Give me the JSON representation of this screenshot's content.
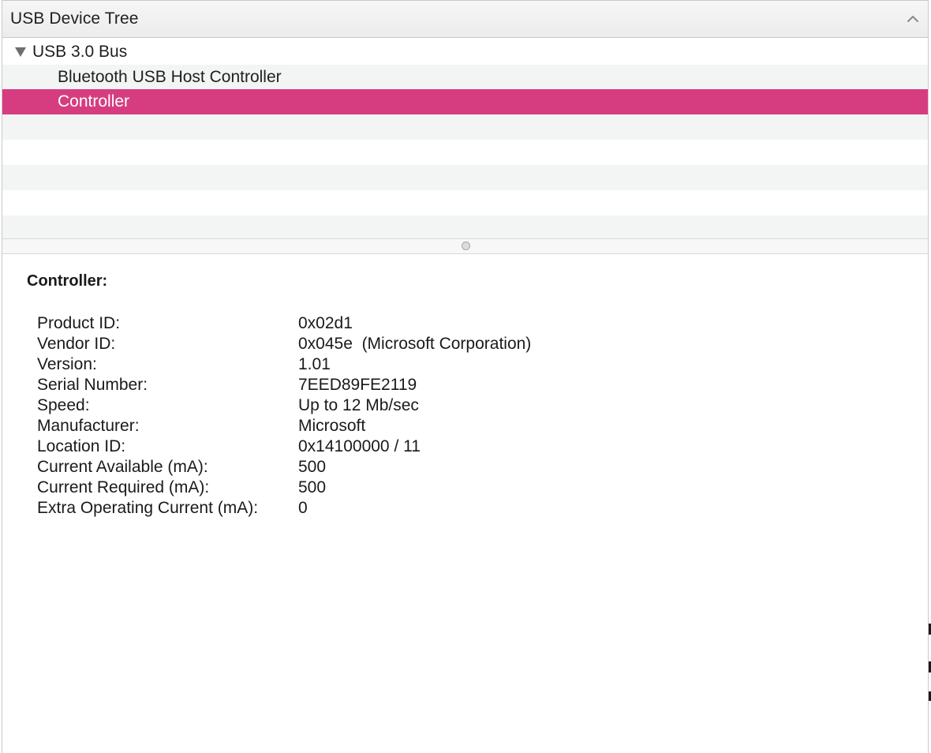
{
  "header": {
    "title": "USB Device Tree",
    "collapse_icon": "chevron-up-icon"
  },
  "tree": {
    "items": [
      {
        "label": "USB 3.0 Bus",
        "level": 0,
        "expanded": true,
        "selected": false
      },
      {
        "label": "Bluetooth USB Host Controller",
        "level": 1,
        "selected": false
      },
      {
        "label": "Controller",
        "level": 1,
        "selected": true
      }
    ],
    "selection_color": "#d63d80"
  },
  "details": {
    "title": "Controller:",
    "properties": [
      {
        "key": "Product ID:",
        "value": "0x02d1"
      },
      {
        "key": "Vendor ID:",
        "value": "0x045e  (Microsoft Corporation)"
      },
      {
        "key": "Version:",
        "value": "1.01"
      },
      {
        "key": "Serial Number:",
        "value": "7EED89FE2119"
      },
      {
        "key": "Speed:",
        "value": "Up to 12 Mb/sec"
      },
      {
        "key": "Manufacturer:",
        "value": "Microsoft"
      },
      {
        "key": "Location ID:",
        "value": "0x14100000 / 11"
      },
      {
        "key": "Current Available (mA):",
        "value": "500"
      },
      {
        "key": "Current Required (mA):",
        "value": "500"
      },
      {
        "key": "Extra Operating Current (mA):",
        "value": "0"
      }
    ]
  }
}
